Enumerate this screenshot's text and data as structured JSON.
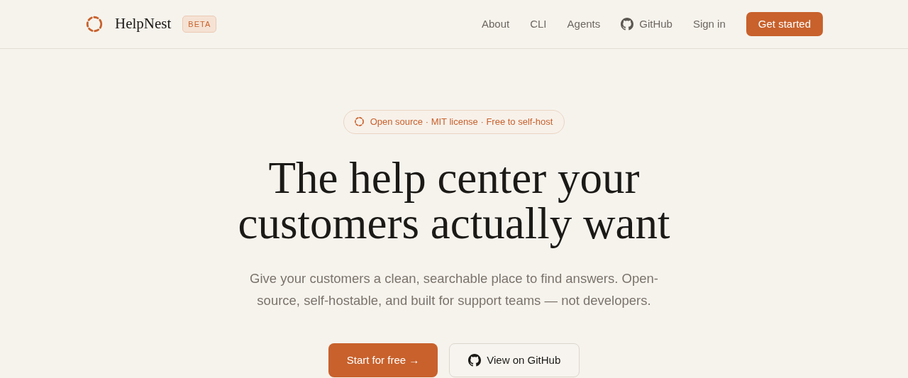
{
  "brand": {
    "name": "HelpNest",
    "badge": "BETA"
  },
  "nav": [
    {
      "label": "About",
      "kind": "text"
    },
    {
      "label": "CLI",
      "kind": "text"
    },
    {
      "label": "Agents",
      "kind": "text"
    },
    {
      "label": "GitHub",
      "kind": "github"
    },
    {
      "label": "Sign in",
      "kind": "text"
    }
  ],
  "nav_cta": "Get started",
  "hero": {
    "pill": "Open source · MIT license · Free to self-host",
    "title_lines": [
      "The help center your",
      "customers actually want"
    ],
    "subtitle": "Give your customers a clean, searchable place to find answers. Open-source, self-hostable, and built for support teams — not developers.",
    "buttons": [
      {
        "label": "Start for free →",
        "kind": "primary"
      },
      {
        "label": "View on GitHub",
        "kind": "github"
      }
    ]
  }
}
